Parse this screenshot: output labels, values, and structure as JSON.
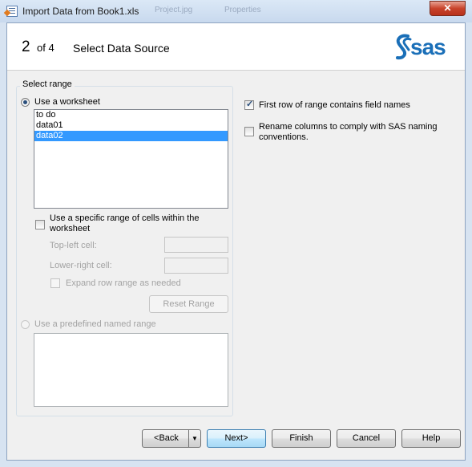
{
  "window": {
    "title": "Import Data from Book1.xls",
    "ghost_tabs": [
      "Project.jpg",
      "Properties"
    ],
    "close_glyph": "✕"
  },
  "wizard": {
    "step_number": "2",
    "step_of": "of 4",
    "step_title": "Select Data Source",
    "logo_text": "sas"
  },
  "select_range": {
    "group_label": "Select range",
    "use_worksheet_label": "Use a worksheet",
    "worksheets": [
      "to do",
      "data01",
      "data02"
    ],
    "selected_worksheet": "data02",
    "specific_range_label": "Use a specific range of cells within the worksheet",
    "top_left_label": "Top-left cell:",
    "top_left_value": "",
    "lower_right_label": "Lower-right cell:",
    "lower_right_value": "",
    "expand_label": "Expand row range as needed",
    "reset_button": "Reset Range",
    "named_range_label": "Use a predefined named range"
  },
  "options": {
    "first_row_label": "First row of range contains field names",
    "first_row_checked": true,
    "rename_label": "Rename columns to comply with SAS naming conventions.",
    "rename_checked": false
  },
  "buttons": {
    "back": "<Back",
    "next": "Next>",
    "finish": "Finish",
    "cancel": "Cancel",
    "help": "Help"
  },
  "colors": {
    "accent": "#3399ff",
    "logo": "#1a6fb8",
    "close": "#c8432b"
  }
}
